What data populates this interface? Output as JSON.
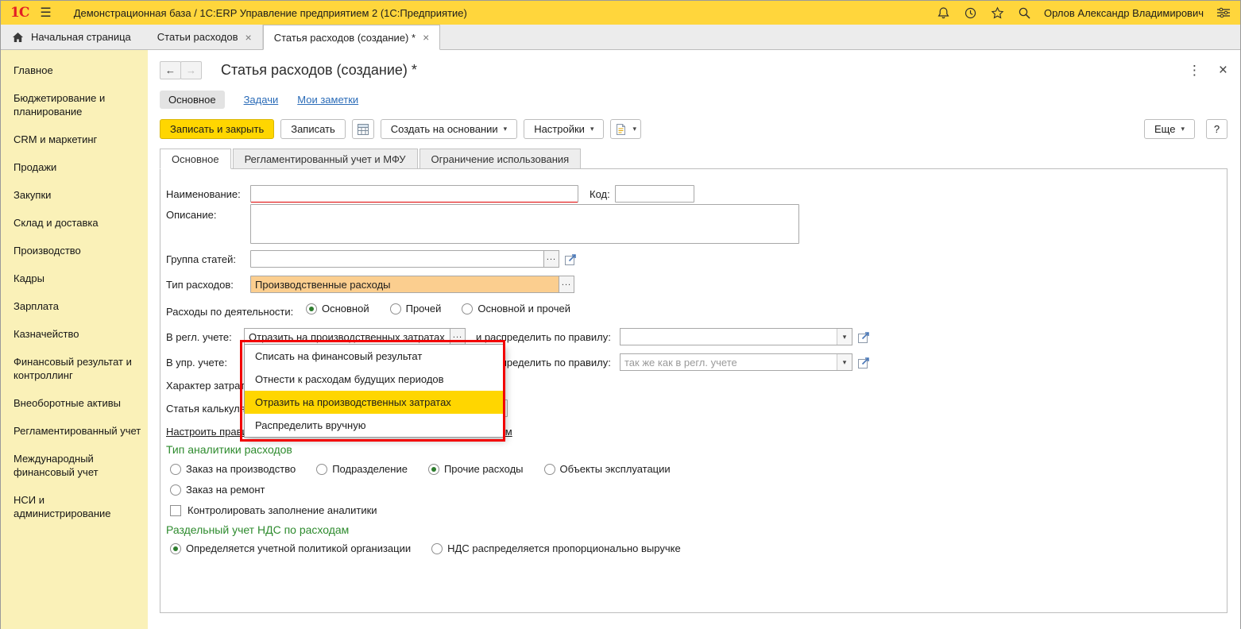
{
  "glyphs": {
    "menu": "☰",
    "back": "←",
    "forward": "→",
    "more_v": "⋮",
    "close": "×",
    "ellipsis": "...",
    "dropdown": "▾",
    "help": "?"
  },
  "topbar": {
    "logo": "1С",
    "title": "Демонстрационная база / 1С:ERP Управление предприятием 2  (1С:Предприятие)",
    "user": "Орлов Александр Владимирович"
  },
  "tabbar": {
    "home_label": "Начальная страница",
    "tabs": [
      {
        "label": "Статьи расходов"
      },
      {
        "label": "Статья расходов (создание) *"
      }
    ]
  },
  "sidebar": {
    "items": [
      "Главное",
      "Бюджетирование и планирование",
      "CRM и маркетинг",
      "Продажи",
      "Закупки",
      "Склад и доставка",
      "Производство",
      "Кадры",
      "Зарплата",
      "Казначейство",
      "Финансовый результат и контроллинг",
      "Внеоборотные активы",
      "Регламентированный учет",
      "Международный финансовый учет",
      "НСИ и администрирование"
    ]
  },
  "doc": {
    "title": "Статья расходов (создание) *",
    "nav": {
      "main": "Основное",
      "tasks": "Задачи",
      "notes": "Мои заметки"
    },
    "toolbar": {
      "save_close": "Записать и закрыть",
      "save": "Записать",
      "create_from": "Создать на основании",
      "settings": "Настройки",
      "more": "Еще",
      "help": "?"
    },
    "form_tabs": [
      {
        "label": "Основное"
      },
      {
        "label": "Регламентированный учет и МФУ"
      },
      {
        "label": "Ограничение использования"
      }
    ]
  },
  "form": {
    "name_label": "Наименование:",
    "code_label": "Код:",
    "description_label": "Описание:",
    "group_label": "Группа статей:",
    "type_label": "Тип расходов:",
    "type_value": "Производственные расходы",
    "activity_label": "Расходы по деятельности:",
    "activity_options": [
      {
        "label": "Основной",
        "checked": true
      },
      {
        "label": "Прочей",
        "checked": false
      },
      {
        "label": "Основной и прочей",
        "checked": false
      }
    ],
    "reg_label": "В регл. учете:",
    "reg_value": "Отразить на производственных затратах",
    "rule_label": "и распределить по правилу:",
    "mgmt_label": "В упр. учете:",
    "mgmt_rule_placeholder": "так же как в регл. учете",
    "nature_label": "Характер затрат:",
    "calc_label": "Статья калькуляции:",
    "setup_link": "Настроить правила распределения по организациям и подразделениям",
    "analytics_header": "Тип аналитики расходов",
    "analytics_row1": [
      {
        "label": "Заказ на производство",
        "checked": false
      },
      {
        "label": "Подразделение",
        "checked": false
      },
      {
        "label": "Прочие расходы",
        "checked": true
      },
      {
        "label": "Объекты эксплуатации",
        "checked": false
      }
    ],
    "analytics_row2": [
      {
        "label": "Заказ на ремонт",
        "checked": false
      }
    ],
    "analytics_checkbox": "Контролировать заполнение аналитики",
    "vat_header": "Раздельный учет НДС по расходам",
    "vat_options": [
      {
        "label": "Определяется учетной политикой организации",
        "checked": true
      },
      {
        "label": "НДС распределяется пропорционально выручке",
        "checked": false
      }
    ]
  },
  "popup": {
    "items": [
      "Списать на финансовый результат",
      "Отнести к расходам будущих периодов",
      "Отразить на производственных затратах",
      "Распределить вручную"
    ],
    "selected_index": 2
  },
  "colors": {
    "accent_yellow": "#FFD600",
    "annotation_red": "#F20000",
    "section_green": "#2E8B2E"
  }
}
